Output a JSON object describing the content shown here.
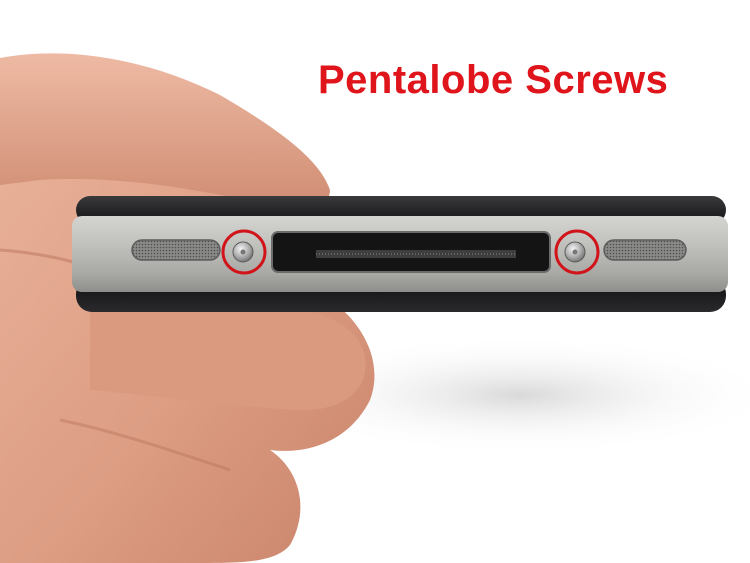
{
  "caption": {
    "text": "Pentalobe Screws",
    "color": "#e0141b"
  },
  "scene": {
    "subject": "phone-bottom-edge",
    "background_color": "#ffffff",
    "skin_color": "#e2a48a",
    "bezel_color": "#1c1c1e",
    "band_color": "#b9b9b6",
    "highlight_color": "#d0141a",
    "screws": [
      "left-screw",
      "right-screw"
    ]
  }
}
